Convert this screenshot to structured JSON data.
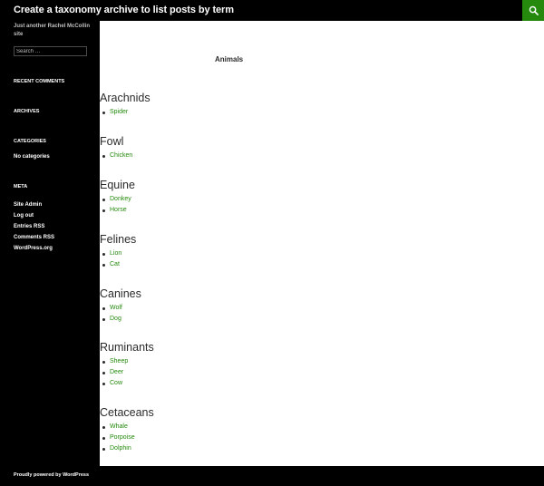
{
  "header": {
    "site_title": "Create a taxonomy archive to list posts by term",
    "search_icon": "search-icon"
  },
  "sidebar": {
    "tagline": "Just another Rachel McCollin site",
    "search_placeholder": "Search …",
    "recent_comments_title": "Recent Comments",
    "archives_title": "Archives",
    "categories_title": "Categories",
    "categories_empty": "No categories",
    "meta_title": "Meta",
    "meta_links": [
      "Site Admin",
      "Log out",
      "Entries RSS",
      "Comments RSS",
      "WordPress.org"
    ]
  },
  "main": {
    "archive_title": "Animals",
    "terms": [
      {
        "name": "Arachnids",
        "posts": [
          "Spider"
        ]
      },
      {
        "name": "Fowl",
        "posts": [
          "Chicken"
        ]
      },
      {
        "name": "Equine",
        "posts": [
          "Donkey",
          "Horse"
        ]
      },
      {
        "name": "Felines",
        "posts": [
          "Lion",
          "Cat"
        ]
      },
      {
        "name": "Canines",
        "posts": [
          "Wolf",
          "Dog"
        ]
      },
      {
        "name": "Ruminants",
        "posts": [
          "Sheep",
          "Deer",
          "Cow"
        ]
      },
      {
        "name": "Cetaceans",
        "posts": [
          "Whale",
          "Porpoise",
          "Dolphin"
        ]
      }
    ]
  },
  "footer": {
    "credit": "Proudly powered by WordPress"
  },
  "colors": {
    "accent": "#24890d",
    "background_dark": "#000000",
    "content_background": "#ffffff",
    "text": "#2b2b2b"
  }
}
